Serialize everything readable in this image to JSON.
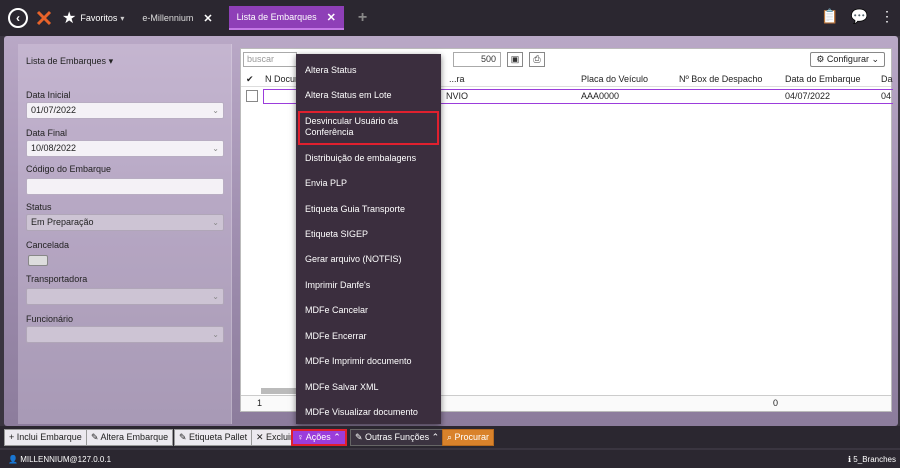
{
  "topbar": {
    "favorites_label": "Favoritos",
    "tabs": [
      {
        "label": "e-Millennium"
      },
      {
        "label": "Lista de Embarques"
      }
    ]
  },
  "filters": {
    "title": "Lista de Embarques",
    "data_inicial_label": "Data Inicial",
    "data_inicial_value": "01/07/2022",
    "data_final_label": "Data Final",
    "data_final_value": "10/08/2022",
    "codigo_label": "Código do Embarque",
    "codigo_value": "",
    "status_label": "Status",
    "status_value": "Em Preparação",
    "cancelada_label": "Cancelada",
    "transportadora_label": "Transportadora",
    "transportadora_value": "",
    "funcionario_label": "Funcionário",
    "funcionario_value": ""
  },
  "grid": {
    "search_placeholder": "buscar",
    "page_size": "500",
    "configure_label": "Configurar",
    "columns": [
      "N Docum",
      "...ra",
      "Placa do Veículo",
      "Nº Box de Despacho",
      "Data do Embarque",
      "Da"
    ],
    "rows": [
      {
        "col2": "NVIO",
        "placa": "AAA0000",
        "box": "",
        "data": "04/07/2022",
        "da": "04"
      }
    ],
    "footer_left": "1",
    "footer_right": "0"
  },
  "menu": {
    "items": [
      {
        "label": "Altera Status"
      },
      {
        "label": "Altera Status em Lote"
      },
      {
        "label": "Desvincular Usuário da\nConferência"
      },
      {
        "label": "Distribuição de embalagens"
      },
      {
        "label": "Envia PLP"
      },
      {
        "label": "Etiqueta Guia Transporte"
      },
      {
        "label": "Etiqueta SIGEP"
      },
      {
        "label": "Gerar arquivo (NOTFIS)"
      },
      {
        "label": "Imprimir Danfe's"
      },
      {
        "label": "MDFe Cancelar"
      },
      {
        "label": "MDFe Encerrar"
      },
      {
        "label": "MDFe Imprimir documento"
      },
      {
        "label": "MDFe Salvar XML"
      },
      {
        "label": "MDFe Visualizar documento"
      }
    ]
  },
  "bottombar": {
    "inclui": "+ Inclui Embarque",
    "altera": "Altera Embarque",
    "etiqueta": "Etiqueta Pallet",
    "exclui": "✕ Excluir",
    "acoes": "Ações",
    "outras": "Outras Funções",
    "procurar": "Procurar"
  },
  "statusbar": {
    "user": "MILLENNIUM@127.0.0.1",
    "branch": "5_Branches"
  },
  "colors": {
    "accent": "#9b3ddb",
    "highlight": "#e0202e",
    "menu_bg": "#3b2e3e",
    "procurar": "#d9822b"
  }
}
